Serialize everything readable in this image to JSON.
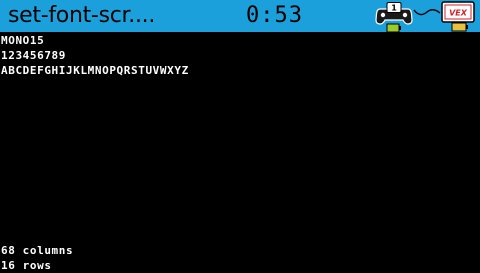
{
  "topbar": {
    "program_name": "set-font-scr....",
    "timer": "0:53",
    "controller_number": "1",
    "brain_label": "VEX"
  },
  "screen": {
    "lines": {
      "font_name": "MONO15",
      "digits": "123456789",
      "alphabet": "ABCDEFGHIJKLMNOPQRSTUVWXYZ",
      "columns": "68 columns",
      "rows": "16 rows"
    }
  },
  "colors": {
    "topbar_bg": "#1ba0dc",
    "screen_bg": "#000000",
    "text": "#ffffff",
    "battery_green": "#9ccc2a",
    "battery_yellow": "#e8c23a",
    "brain_accent": "#d62027"
  },
  "icons": [
    "controller-icon",
    "link-icon",
    "brain-icon",
    "battery-icon"
  ]
}
